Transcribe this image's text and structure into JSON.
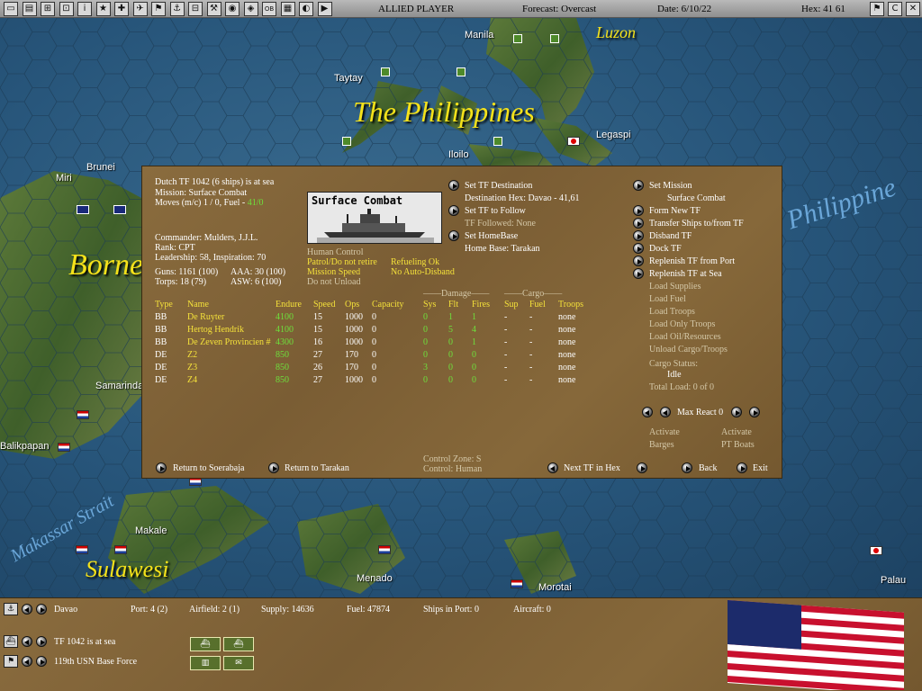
{
  "topbar": {
    "player": "ALLIED PLAYER",
    "forecast": "Forecast: Overcast",
    "date": "Date: 6/10/22",
    "hex": "Hex: 41 61",
    "buttons": [
      "▭",
      "▤",
      "⊞",
      "⊡",
      "i",
      "★",
      "✚",
      "✈",
      "⚑",
      "⚓",
      "⊟",
      "⚒",
      "◉",
      "◈",
      "OB",
      "▦",
      "◐",
      "▶"
    ],
    "right_buttons": [
      "⚑",
      "C",
      "✕"
    ]
  },
  "map": {
    "places": [
      "Manila",
      "Taytay",
      "Iloilo",
      "Legaspi",
      "Brunei",
      "Miri",
      "Samarinda",
      "Balikpapan",
      "Makale",
      "Menado",
      "Morotai",
      "Palau"
    ],
    "regions": [
      "Luzon",
      "The Philippines",
      "Borneo",
      "Sulawesi",
      "Philippine"
    ],
    "sea": "Makassar Strait"
  },
  "dialog": {
    "tf_title": "Dutch TF 1042 (6 ships) is at sea",
    "mission": "Mission: Surface Combat",
    "moves_prefix": "Moves (m/c) 1 / 0, Fuel - ",
    "fuel": "41/0",
    "commander": "Commander: Mulders, J.J.L.",
    "rank": "Rank: CPT",
    "leadership": "Leadership: 58, Inspiration: 70",
    "guns": "Guns: 1161 (100)",
    "aaa": "AAA: 30 (100)",
    "torps": "Torps: 18 (79)",
    "asw": "ASW: 6 (100)",
    "combat_title": "Surface Combat",
    "human_control": "Human Control",
    "patrol": "Patrol/Do not retire",
    "refuel": "Refueling Ok",
    "mission_speed": "Mission Speed",
    "auto_disband": "No Auto-Disband",
    "do_not_unload": "Do not Unload",
    "damage_header": "Damage",
    "cargo_header": "Cargo",
    "columns": [
      "Type",
      "Name",
      "Endure",
      "Speed",
      "Ops",
      "Capacity",
      "Sys",
      "Flt",
      "Fires",
      "Sup",
      "Fuel",
      "Troops"
    ],
    "ships": [
      {
        "type": "BB",
        "name": "De Ruyter",
        "endure": "4100",
        "speed": "15",
        "ops": "1000",
        "cap": "0",
        "sys": "0",
        "flt": "1",
        "fires": "1",
        "sup": "-",
        "fuel": "-",
        "troops": "none"
      },
      {
        "type": "BB",
        "name": "Hertog Hendrik",
        "endure": "4100",
        "speed": "15",
        "ops": "1000",
        "cap": "0",
        "sys": "0",
        "flt": "5",
        "fires": "4",
        "sup": "-",
        "fuel": "-",
        "troops": "none"
      },
      {
        "type": "BB",
        "name": "De Zeven Provincien #",
        "endure": "4300",
        "speed": "16",
        "ops": "1000",
        "cap": "0",
        "sys": "0",
        "flt": "0",
        "fires": "1",
        "sup": "-",
        "fuel": "-",
        "troops": "none"
      },
      {
        "type": "DE",
        "name": "Z2",
        "endure": "850",
        "speed": "27",
        "ops": "170",
        "cap": "0",
        "sys": "0",
        "flt": "0",
        "fires": "0",
        "sup": "-",
        "fuel": "-",
        "troops": "none"
      },
      {
        "type": "DE",
        "name": "Z3",
        "endure": "850",
        "speed": "26",
        "ops": "170",
        "cap": "0",
        "sys": "3",
        "flt": "0",
        "fires": "0",
        "sup": "-",
        "fuel": "-",
        "troops": "none"
      },
      {
        "type": "DE",
        "name": "Z4",
        "endure": "850",
        "speed": "27",
        "ops": "1000",
        "cap": "0",
        "sys": "0",
        "flt": "0",
        "fires": "0",
        "sup": "-",
        "fuel": "-",
        "troops": "none"
      }
    ],
    "set_destination": "Set TF Destination",
    "destination_hex": "Destination Hex: Davao - 41,61",
    "set_follow": "Set TF to Follow",
    "followed": "TF Followed: None",
    "set_homebase": "Set HomeBase",
    "home_base": "Home Base: Tarakan",
    "set_mission": "Set Mission",
    "mission_value": "Surface Combat",
    "right_actions": [
      "Form New TF",
      "Transfer Ships to/from TF",
      "Disband TF",
      "Dock TF",
      "Replenish TF from Port",
      "Replenish TF at Sea"
    ],
    "disabled_actions": [
      "Load Supplies",
      "Load Fuel",
      "Load Troops",
      "Load Only Troops",
      "Load Oil/Resources",
      "Unload Cargo/Troops"
    ],
    "cargo_status": "Cargo Status:",
    "cargo_state": "Idle",
    "total_load": "Total Load: 0 of 0",
    "max_react": "Max React 0",
    "activate_barges": [
      "Activate",
      "Barges"
    ],
    "activate_pt": [
      "Activate",
      "PT Boats"
    ],
    "return_soerabaja": "Return to Soerabaja",
    "return_tarakan": "Return to Tarakan",
    "control_zone": "Control Zone: S",
    "control": "Control:    Human",
    "next_tf": "Next TF in Hex",
    "back": "Back",
    "exit": "Exit"
  },
  "bottom": {
    "base": "Davao",
    "port": "Port: 4 (2)",
    "airfield": "Airfield: 2 (1)",
    "supply": "Supply: 14636",
    "fuel": "Fuel: 47874",
    "ships_in_port": "Ships in Port: 0",
    "aircraft": "Aircraft: 0",
    "tf_line": "TF 1042 is at sea",
    "unit_line": "119th USN Base Force"
  },
  "colors": {
    "panel": "#7e6037",
    "highlight": "#f4e13a",
    "ok": "#6ee03c"
  }
}
